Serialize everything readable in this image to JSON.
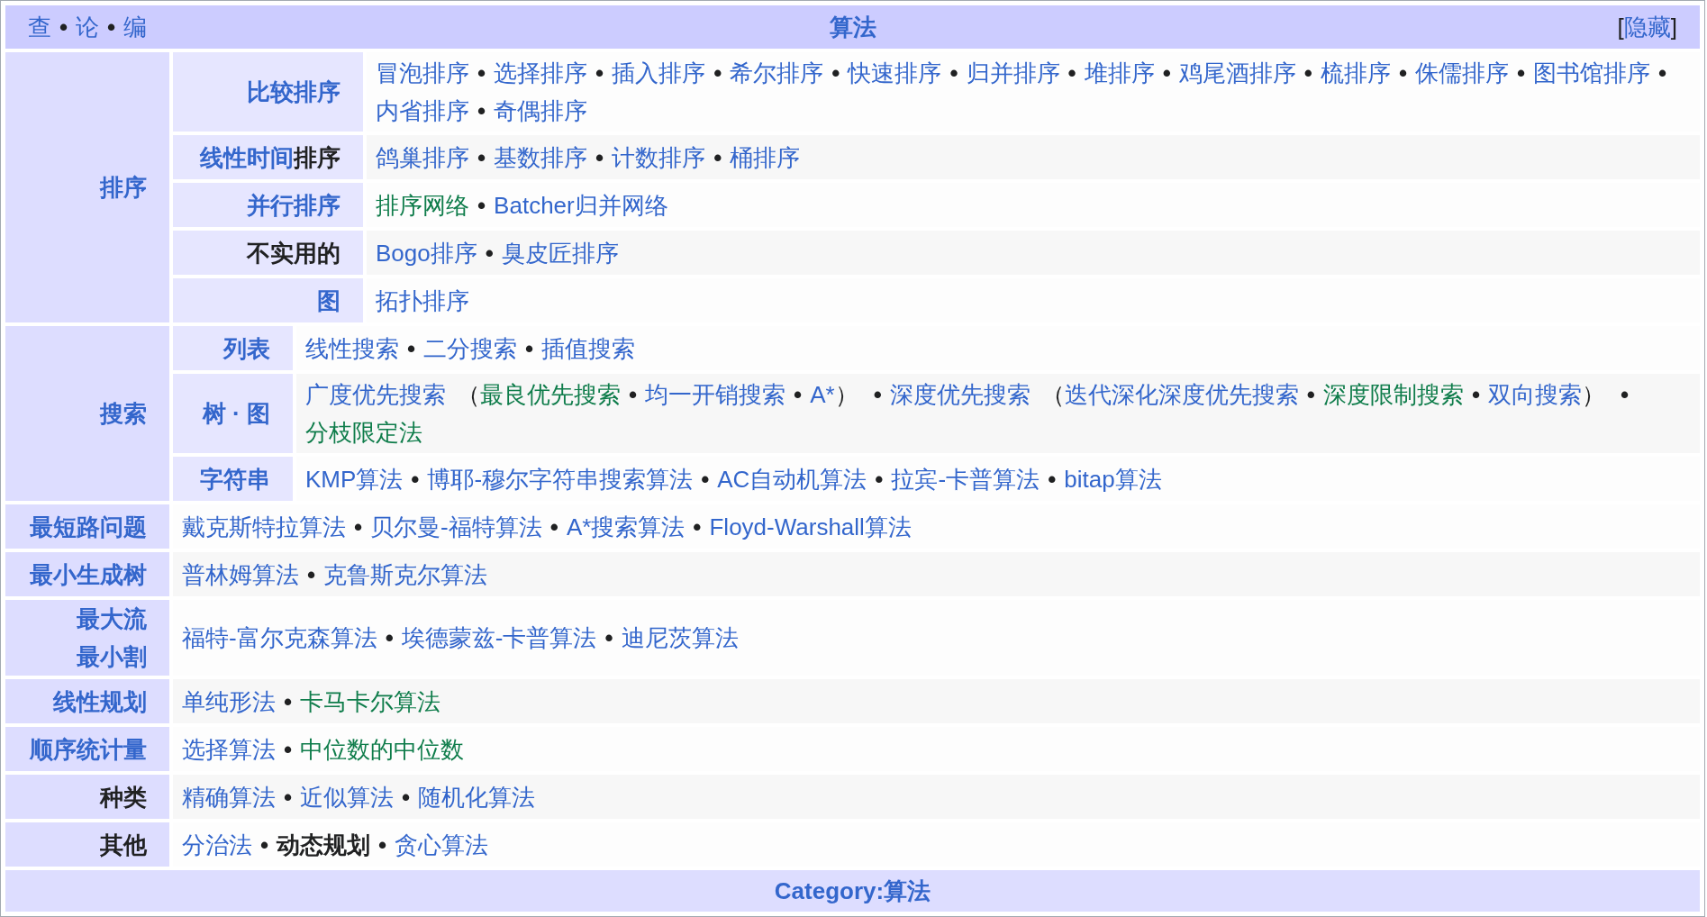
{
  "header": {
    "links": [
      {
        "text": "查",
        "kind": "link"
      },
      {
        "text": "•",
        "kind": "sep"
      },
      {
        "text": "论",
        "kind": "link"
      },
      {
        "text": "•",
        "kind": "sep"
      },
      {
        "text": "编",
        "kind": "link"
      }
    ],
    "title": "算法",
    "toggle": [
      {
        "text": "[",
        "kind": "plain"
      },
      {
        "text": "隐藏",
        "kind": "link"
      },
      {
        "text": "]",
        "kind": "plain"
      }
    ]
  },
  "groups": [
    {
      "label": [
        {
          "text": "排序",
          "kind": "link"
        }
      ],
      "subgroups": [
        {
          "label": [
            {
              "text": "比较排序",
              "kind": "link"
            }
          ],
          "items": [
            {
              "text": "冒泡排序",
              "kind": "link"
            },
            {
              "text": "•",
              "kind": "sep"
            },
            {
              "text": "选择排序",
              "kind": "link"
            },
            {
              "text": "•",
              "kind": "sep"
            },
            {
              "text": "插入排序",
              "kind": "link"
            },
            {
              "text": "•",
              "kind": "sep"
            },
            {
              "text": "希尔排序",
              "kind": "link"
            },
            {
              "text": "•",
              "kind": "sep"
            },
            {
              "text": "快速排序",
              "kind": "link"
            },
            {
              "text": "•",
              "kind": "sep"
            },
            {
              "text": "归并排序",
              "kind": "link"
            },
            {
              "text": "•",
              "kind": "sep"
            },
            {
              "text": "堆排序",
              "kind": "link"
            },
            {
              "text": "•",
              "kind": "sep"
            },
            {
              "text": "鸡尾酒排序",
              "kind": "link"
            },
            {
              "text": "•",
              "kind": "sep"
            },
            {
              "text": "梳排序",
              "kind": "link"
            },
            {
              "text": "•",
              "kind": "sep"
            },
            {
              "text": "侏儒排序",
              "kind": "link"
            },
            {
              "text": "•",
              "kind": "sep"
            },
            {
              "text": "图书馆排序",
              "kind": "link"
            },
            {
              "text": "•",
              "kind": "sep"
            },
            {
              "text": "内省排序",
              "kind": "link"
            },
            {
              "text": "•",
              "kind": "sep"
            },
            {
              "text": "奇偶排序",
              "kind": "link"
            }
          ]
        },
        {
          "label": [
            {
              "text": "线性时间",
              "kind": "link"
            },
            {
              "text": "排序",
              "kind": "plain"
            }
          ],
          "items": [
            {
              "text": "鸽巢排序",
              "kind": "link"
            },
            {
              "text": "•",
              "kind": "sep"
            },
            {
              "text": "基数排序",
              "kind": "link"
            },
            {
              "text": "•",
              "kind": "sep"
            },
            {
              "text": "计数排序",
              "kind": "link"
            },
            {
              "text": "•",
              "kind": "sep"
            },
            {
              "text": "桶排序",
              "kind": "link"
            }
          ]
        },
        {
          "label": [
            {
              "text": "并行排序",
              "kind": "link"
            }
          ],
          "items": [
            {
              "text": "排序网络",
              "kind": "ilink"
            },
            {
              "text": "•",
              "kind": "sep"
            },
            {
              "text": "Batcher归并网络",
              "kind": "link"
            }
          ]
        },
        {
          "label": [
            {
              "text": "不实用的",
              "kind": "plain"
            }
          ],
          "items": [
            {
              "text": "Bogo排序",
              "kind": "link"
            },
            {
              "text": "•",
              "kind": "sep"
            },
            {
              "text": "臭皮匠排序",
              "kind": "link"
            }
          ]
        },
        {
          "label": [
            {
              "text": "图",
              "kind": "link"
            }
          ],
          "items": [
            {
              "text": "拓扑排序",
              "kind": "link"
            }
          ]
        }
      ]
    },
    {
      "label": [
        {
          "text": "搜索",
          "kind": "link"
        }
      ],
      "subgroups": [
        {
          "label": [
            {
              "text": "列表",
              "kind": "link"
            }
          ],
          "items": [
            {
              "text": "线性搜索",
              "kind": "link"
            },
            {
              "text": "•",
              "kind": "sep"
            },
            {
              "text": "二分搜索",
              "kind": "link"
            },
            {
              "text": "•",
              "kind": "sep"
            },
            {
              "text": "插值搜索",
              "kind": "link"
            }
          ]
        },
        {
          "label": [
            {
              "text": "树 · 图",
              "kind": "link"
            }
          ],
          "items": [
            {
              "text": "广度优先搜索",
              "kind": "link"
            },
            {
              "text": "（",
              "kind": "open"
            },
            {
              "text": "最良优先搜索",
              "kind": "ilink"
            },
            {
              "text": "•",
              "kind": "sep"
            },
            {
              "text": "均一开销搜索",
              "kind": "link"
            },
            {
              "text": "•",
              "kind": "sep"
            },
            {
              "text": "A*",
              "kind": "link"
            },
            {
              "text": "）",
              "kind": "close"
            },
            {
              "text": "•",
              "kind": "sep"
            },
            {
              "text": "深度优先搜索",
              "kind": "link"
            },
            {
              "text": "（",
              "kind": "open"
            },
            {
              "text": "迭代深化深度优先搜索",
              "kind": "link"
            },
            {
              "text": "•",
              "kind": "sep"
            },
            {
              "text": "深度限制搜索",
              "kind": "ilink"
            },
            {
              "text": "•",
              "kind": "sep"
            },
            {
              "text": "双向搜索",
              "kind": "link"
            },
            {
              "text": "）",
              "kind": "close"
            },
            {
              "text": "•",
              "kind": "sep"
            },
            {
              "text": "分枝限定法",
              "kind": "ilink"
            }
          ]
        },
        {
          "label": [
            {
              "text": "字符串",
              "kind": "link"
            }
          ],
          "items": [
            {
              "text": "KMP算法",
              "kind": "link"
            },
            {
              "text": "•",
              "kind": "sep"
            },
            {
              "text": "博耶-穆尔字符串搜索算法",
              "kind": "link"
            },
            {
              "text": "•",
              "kind": "sep"
            },
            {
              "text": "AC自动机算法",
              "kind": "link"
            },
            {
              "text": "•",
              "kind": "sep"
            },
            {
              "text": "拉宾-卡普算法",
              "kind": "link"
            },
            {
              "text": "•",
              "kind": "sep"
            },
            {
              "text": "bitap算法",
              "kind": "link"
            }
          ]
        }
      ]
    },
    {
      "label": [
        {
          "text": "最短路问题",
          "kind": "link"
        }
      ],
      "items": [
        {
          "text": "戴克斯特拉算法",
          "kind": "link"
        },
        {
          "text": "•",
          "kind": "sep"
        },
        {
          "text": "贝尔曼-福特算法",
          "kind": "link"
        },
        {
          "text": "•",
          "kind": "sep"
        },
        {
          "text": "A*搜索算法",
          "kind": "link"
        },
        {
          "text": "•",
          "kind": "sep"
        },
        {
          "text": "Floyd-Warshall算法",
          "kind": "link"
        }
      ]
    },
    {
      "label": [
        {
          "text": "最小生成树",
          "kind": "link"
        }
      ],
      "items": [
        {
          "text": "普林姆算法",
          "kind": "link"
        },
        {
          "text": "•",
          "kind": "sep"
        },
        {
          "text": "克鲁斯克尔算法",
          "kind": "link"
        }
      ]
    },
    {
      "label": [
        {
          "text": "最大流",
          "kind": "link"
        },
        {
          "text": "最小割",
          "kind": "link",
          "newline": true
        }
      ],
      "items": [
        {
          "text": "福特-富尔克森算法",
          "kind": "link"
        },
        {
          "text": "•",
          "kind": "sep"
        },
        {
          "text": "埃德蒙兹-卡普算法",
          "kind": "link"
        },
        {
          "text": "•",
          "kind": "sep"
        },
        {
          "text": "迪尼茨算法",
          "kind": "link"
        }
      ]
    },
    {
      "label": [
        {
          "text": "线性规划",
          "kind": "link"
        }
      ],
      "items": [
        {
          "text": "单纯形法",
          "kind": "link"
        },
        {
          "text": "•",
          "kind": "sep"
        },
        {
          "text": "卡马卡尔算法",
          "kind": "ilink"
        }
      ]
    },
    {
      "label": [
        {
          "text": "顺序统计量",
          "kind": "link"
        }
      ],
      "items": [
        {
          "text": "选择算法",
          "kind": "link"
        },
        {
          "text": "•",
          "kind": "sep"
        },
        {
          "text": "中位数的中位数",
          "kind": "ilink"
        }
      ]
    },
    {
      "label": [
        {
          "text": "种类",
          "kind": "plain"
        }
      ],
      "items": [
        {
          "text": "精确算法",
          "kind": "link"
        },
        {
          "text": "•",
          "kind": "sep"
        },
        {
          "text": "近似算法",
          "kind": "link"
        },
        {
          "text": "•",
          "kind": "sep"
        },
        {
          "text": "随机化算法",
          "kind": "link"
        }
      ]
    },
    {
      "label": [
        {
          "text": "其他",
          "kind": "plain"
        }
      ],
      "items": [
        {
          "text": "分治法",
          "kind": "link"
        },
        {
          "text": "•",
          "kind": "sep"
        },
        {
          "text": "动态规划",
          "kind": "self"
        },
        {
          "text": "•",
          "kind": "sep"
        },
        {
          "text": "贪心算法",
          "kind": "link"
        }
      ]
    }
  ],
  "footer": {
    "text": "Category:算法"
  }
}
